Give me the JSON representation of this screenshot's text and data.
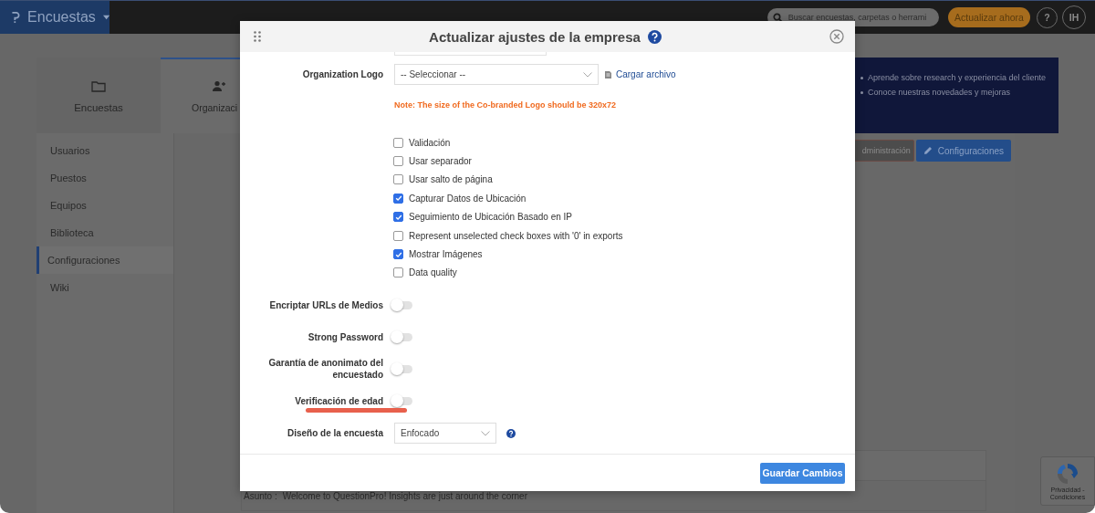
{
  "app": {
    "product": "Encuestas",
    "search": {
      "placeholder": "Buscar encuestas, carpetas o herrami"
    },
    "upgrade_button": "Actualizar ahora",
    "help": "?",
    "user_initials": "IH"
  },
  "top_tabs": [
    {
      "label": "Encuestas",
      "selected": false
    },
    {
      "label": "Organizaci",
      "selected": true
    }
  ],
  "banner": {
    "items": [
      "Aprende sobre research y experiencia del cliente",
      "Conoce nuestras novedades y mejoras"
    ]
  },
  "sidebar": {
    "items": [
      {
        "label": "Usuarios",
        "selected": false
      },
      {
        "label": "Puestos",
        "selected": false
      },
      {
        "label": "Equipos",
        "selected": false
      },
      {
        "label": "Biblioteca",
        "selected": false
      },
      {
        "label": "Configuraciones",
        "selected": true
      },
      {
        "label": "Wiki",
        "selected": false
      }
    ]
  },
  "main": {
    "buttons": [
      {
        "label": "dministración",
        "kind": "admin"
      },
      {
        "label": "Configuraciones",
        "kind": "settings"
      }
    ],
    "message": {
      "label": "Asunto :",
      "text": "Welcome to QuestionPro! Insights are just around the corner"
    }
  },
  "captcha": {
    "text": "Privacidad - Condiciones"
  },
  "dialog": {
    "title": "Actualizar ajustes de la empresa",
    "logo": {
      "label": "Organization Logo",
      "select": "-- Seleccionar --",
      "upload_link": "Cargar archivo"
    },
    "note": "Note: The size of the Co-branded Logo should be 320x72",
    "checkboxes": [
      {
        "label": "Validación",
        "checked": false
      },
      {
        "label": "Usar separador",
        "checked": false
      },
      {
        "label": "Usar salto de página",
        "checked": false
      },
      {
        "label": "Capturar Datos de Ubicación",
        "checked": true
      },
      {
        "label": "Seguimiento de Ubicación Basado en IP",
        "checked": true
      },
      {
        "label": "Represent unselected check boxes with '0' in exports",
        "checked": false
      },
      {
        "label": "Mostrar Imágenes",
        "checked": true
      },
      {
        "label": "Data quality",
        "checked": false
      }
    ],
    "toggles": [
      {
        "label": "Encriptar URLs de Medios",
        "on": false,
        "highlighted": false
      },
      {
        "label": "Strong Password",
        "on": false,
        "highlighted": false
      },
      {
        "label": "Garantía de anonimato del encuestado",
        "on": false,
        "highlighted": false
      },
      {
        "label": "Verificación de edad",
        "on": false,
        "highlighted": true
      }
    ],
    "survey_design": {
      "label": "Diseño de la encuesta",
      "value": "Enfocado"
    },
    "save_button": "Guardar Cambios"
  }
}
